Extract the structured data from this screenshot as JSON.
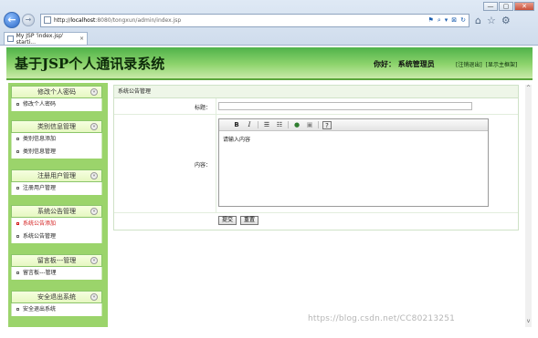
{
  "browser": {
    "window_controls": {
      "minimize": "—",
      "maximize": "▢",
      "close": "✕"
    },
    "back_label": "←",
    "forward_label": "→",
    "address": {
      "scheme_prefix": "http://",
      "host": "localhost",
      "path": ":8080/tongxun/admin/index.jsp"
    },
    "addr_tools": [
      "⚑",
      "⌕",
      "▾",
      "⊠",
      "↻"
    ],
    "right_icons": [
      "⌂",
      "☆",
      "⚙"
    ],
    "tab": {
      "title": "My JSP 'index.jsp' starti...",
      "close": "×"
    }
  },
  "header": {
    "site_title": "基于JSP个人通讯录系统",
    "greeting": "你好：  系统管理员",
    "links": [
      "[注销退出]",
      "[显示主框架]"
    ]
  },
  "sidebar": {
    "groups": [
      {
        "title": "修改个人密码",
        "items": [
          {
            "label": "修改个人密码",
            "active": false
          }
        ]
      },
      {
        "title": "类别信息管理",
        "items": [
          {
            "label": "类别信息添加",
            "active": false
          },
          {
            "label": "类别信息管理",
            "active": false
          }
        ]
      },
      {
        "title": "注册用户管理",
        "items": [
          {
            "label": "注册用户管理",
            "active": false
          }
        ]
      },
      {
        "title": "系统公告管理",
        "items": [
          {
            "label": "系统公告添加",
            "active": true
          },
          {
            "label": "系统公告管理",
            "active": false
          }
        ]
      },
      {
        "title": "留言板---管理",
        "items": [
          {
            "label": "留言板---管理",
            "active": false
          }
        ]
      },
      {
        "title": "安全退出系统",
        "items": [
          {
            "label": "安全退出系统",
            "active": false
          }
        ]
      }
    ],
    "collapse_glyph": "«"
  },
  "main": {
    "section_title": "系统公告管理",
    "title_label": "标题：",
    "title_value": "",
    "content_label": "内容：",
    "editor": {
      "toolbar": [
        "B",
        "I",
        "☰",
        "☷",
        "●",
        "▣",
        "?"
      ],
      "content": "请输入内容"
    },
    "submit_label": "提交",
    "reset_label": "重置"
  },
  "watermark": "https://blog.csdn.net/CC80213251"
}
